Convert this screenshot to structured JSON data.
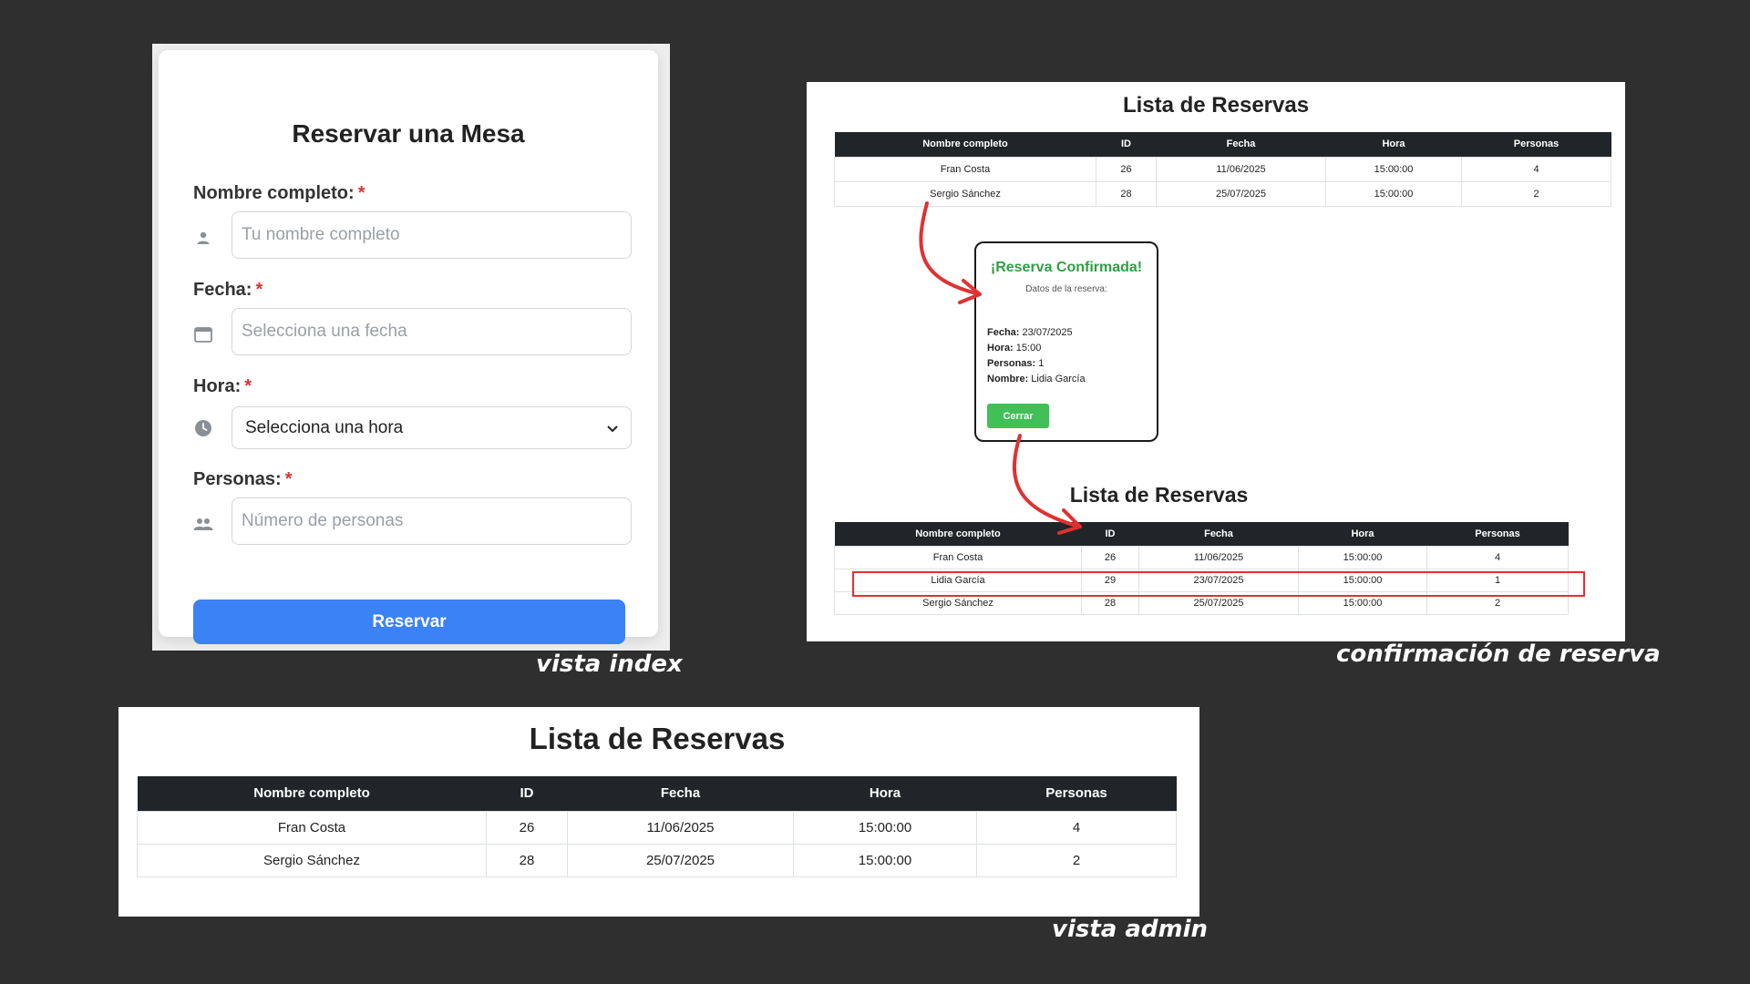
{
  "index_view": {
    "title": "Reservar una Mesa",
    "fields": {
      "name": {
        "label": "Nombre completo:",
        "required": "*",
        "placeholder": "Tu nombre completo",
        "icon": "user-icon"
      },
      "date": {
        "label": "Fecha:",
        "required": "*",
        "placeholder": "Selecciona una fecha",
        "icon": "calendar-icon"
      },
      "time": {
        "label": "Hora:",
        "required": "*",
        "selected": "Selecciona una hora",
        "icon": "clock-icon"
      },
      "people": {
        "label": "Personas:",
        "required": "*",
        "placeholder": "Número de personas",
        "icon": "users-icon"
      }
    },
    "submit_label": "Reservar",
    "caption": "vista index"
  },
  "confirm_view": {
    "top_list": {
      "title": "Lista de Reservas",
      "headers": [
        "Nombre completo",
        "ID",
        "Fecha",
        "Hora",
        "Personas"
      ],
      "rows": [
        [
          "Fran Costa",
          "26",
          "11/06/2025",
          "15:00:00",
          "4"
        ],
        [
          "Sergio Sánchez",
          "28",
          "25/07/2025",
          "15:00:00",
          "2"
        ]
      ]
    },
    "modal": {
      "title": "¡Reserva Confirmada!",
      "subtitle": "Datos de la reserva:",
      "details": [
        {
          "label": "Fecha:",
          "value": "23/07/2025"
        },
        {
          "label": "Hora:",
          "value": "15:00"
        },
        {
          "label": "Personas:",
          "value": "1"
        },
        {
          "label": "Nombre:",
          "value": "Lidia García"
        }
      ],
      "close_label": "Cerrar"
    },
    "bottom_list": {
      "title": "Lista de Reservas",
      "headers": [
        "Nombre completo",
        "ID",
        "Fecha",
        "Hora",
        "Personas"
      ],
      "rows": [
        [
          "Fran Costa",
          "26",
          "11/06/2025",
          "15:00:00",
          "4"
        ],
        [
          "Lidia García",
          "29",
          "23/07/2025",
          "15:00:00",
          "1"
        ],
        [
          "Sergio Sánchez",
          "28",
          "25/07/2025",
          "15:00:00",
          "2"
        ]
      ]
    },
    "caption": "confirmación de reserva",
    "accent_color": "#e03131"
  },
  "admin_view": {
    "title": "Lista de Reservas",
    "headers": [
      "Nombre completo",
      "ID",
      "Fecha",
      "Hora",
      "Personas"
    ],
    "rows": [
      [
        "Fran Costa",
        "26",
        "11/06/2025",
        "15:00:00",
        "4"
      ],
      [
        "Sergio Sánchez",
        "28",
        "25/07/2025",
        "15:00:00",
        "2"
      ]
    ],
    "caption": "vista admin"
  },
  "colors": {
    "background": "#2f2f2f",
    "primary_button": "#3b82f6",
    "success": "#2f9e44",
    "table_header": "#212529"
  }
}
